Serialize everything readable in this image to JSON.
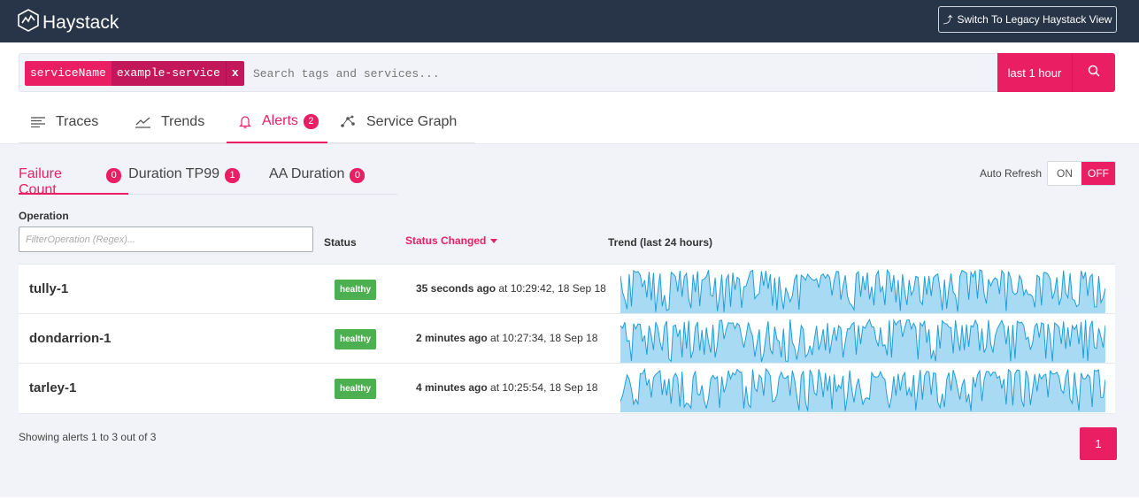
{
  "header": {
    "app_name": "Haystack",
    "legacy_button_label": "Switch To Legacy Haystack View"
  },
  "search": {
    "chip_key": "serviceName",
    "chip_value": "example-service",
    "chip_remove": "x",
    "placeholder": "Search tags and services...",
    "time_range": "last 1 hour"
  },
  "main_tabs": [
    {
      "label": "Traces",
      "icon": "list-icon"
    },
    {
      "label": "Trends",
      "icon": "line-chart-icon"
    },
    {
      "label": "Alerts",
      "icon": "bell-icon",
      "badge": "2",
      "active": true
    },
    {
      "label": "Service Graph",
      "icon": "graph-icon"
    }
  ],
  "sub_tabs": [
    {
      "label": "Failure Count",
      "badge": "0",
      "active": true
    },
    {
      "label": "Duration TP99",
      "badge": "1"
    },
    {
      "label": "AA Duration",
      "badge": "0"
    }
  ],
  "auto_refresh": {
    "label": "Auto Refresh",
    "on_label": "ON",
    "off_label": "OFF",
    "state": "OFF"
  },
  "table": {
    "col_operation": "Operation",
    "filter_placeholder": "FilterOperation (Regex)...",
    "col_status": "Status",
    "col_status_changed": "Status Changed",
    "col_trend": "Trend (last 24 hours)",
    "rows": [
      {
        "operation": "tully-1",
        "status": "healthy",
        "changed_rel": "35 seconds ago",
        "changed_abs": " at 10:29:42, 18 Sep 18"
      },
      {
        "operation": "dondarrion-1",
        "status": "healthy",
        "changed_rel": "2 minutes ago",
        "changed_abs": " at 10:27:34, 18 Sep 18"
      },
      {
        "operation": "tarley-1",
        "status": "healthy",
        "changed_rel": "4 minutes ago",
        "changed_abs": " at 10:25:54, 18 Sep 18"
      }
    ]
  },
  "footer": {
    "summary": "Showing alerts 1 to 3 out of 3",
    "current_page": "1"
  },
  "colors": {
    "accent": "#e91e63",
    "header_bg": "#283447",
    "healthy": "#4caf50",
    "spark_fill": "#a8daf3",
    "spark_line": "#1e9fd8"
  }
}
